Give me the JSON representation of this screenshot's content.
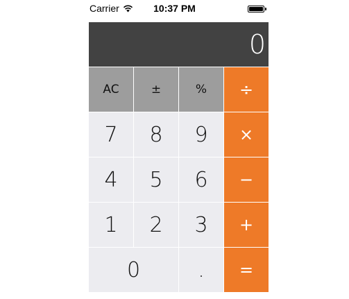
{
  "status_bar": {
    "carrier": "Carrier",
    "time": "10:37 PM",
    "wifi_icon": "wifi-icon",
    "battery_icon": "battery-icon"
  },
  "display": {
    "value": "0"
  },
  "keys": {
    "ac": "AC",
    "plus_minus": "±",
    "percent": "%",
    "divide": "÷",
    "seven": "7",
    "eight": "8",
    "nine": "9",
    "multiply": "×",
    "four": "4",
    "five": "5",
    "six": "6",
    "minus": "−",
    "one": "1",
    "two": "2",
    "three": "3",
    "plus": "+",
    "zero": "0",
    "decimal": ".",
    "equals": "="
  },
  "colors": {
    "display_bg": "#424242",
    "function_key_bg": "#9d9d9d",
    "number_key_bg": "#ececf0",
    "operator_key_bg": "#ee7a28"
  }
}
